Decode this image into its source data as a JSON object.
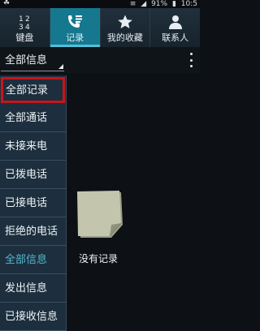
{
  "status_bar": {
    "usb_icon": "usb-icon",
    "battery_text": "91%",
    "time": "10:5"
  },
  "tabs": [
    {
      "label": "键盘",
      "icon": "dialpad-icon",
      "active": false
    },
    {
      "label": "记录",
      "icon": "call-log-icon",
      "active": true
    },
    {
      "label": "我的收藏",
      "icon": "star-icon",
      "active": false
    },
    {
      "label": "联系人",
      "icon": "contact-icon",
      "active": false
    }
  ],
  "dialpad_digits": [
    "1",
    "2",
    "3",
    "4"
  ],
  "filter": {
    "selected": "全部信息",
    "overflow_icon": "more-vert-icon"
  },
  "menu": {
    "items": [
      {
        "label": "全部记录",
        "highlighted": true
      },
      {
        "label": "全部通话"
      },
      {
        "label": "未接来电"
      },
      {
        "label": "已拨电话"
      },
      {
        "label": "已接电话"
      },
      {
        "label": "拒绝的电话"
      },
      {
        "label": "全部信息",
        "dim": true
      },
      {
        "label": "发出信息"
      },
      {
        "label": "已接收信息"
      }
    ]
  },
  "empty_state": {
    "icon": "note-icon",
    "text": "没有记录"
  },
  "colors": {
    "active_tab": "#15788f",
    "highlight_border": "#c8151b",
    "dim_item_text": "#54b7cf"
  }
}
